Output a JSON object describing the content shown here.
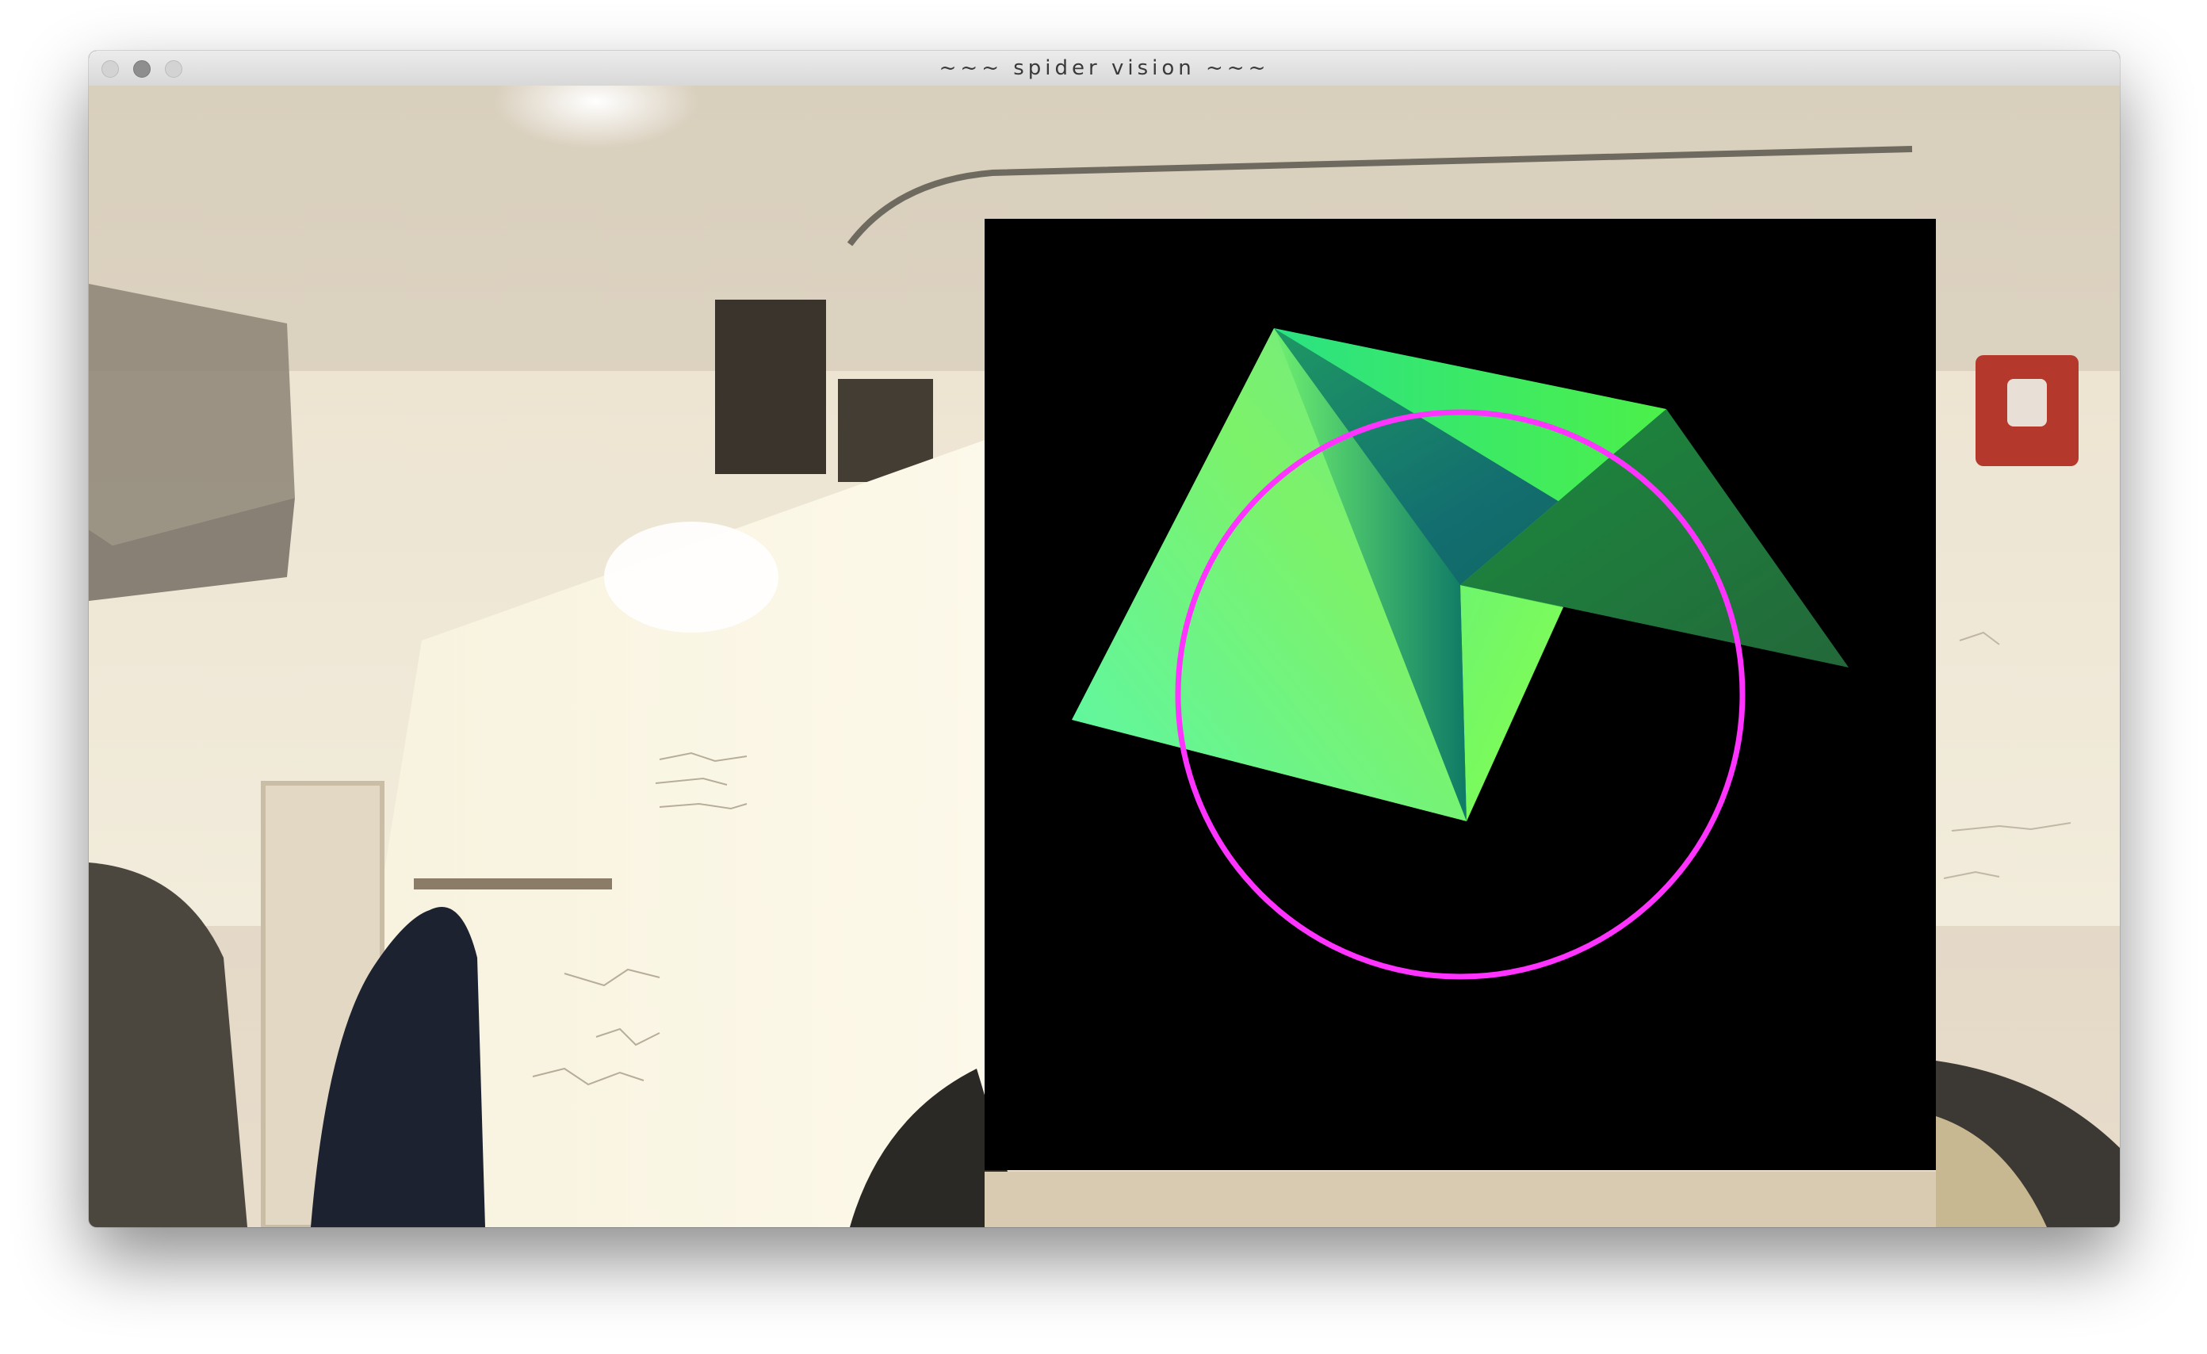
{
  "window": {
    "title": "~~~ spider vision ~~~"
  },
  "icons": {
    "close": "close-icon",
    "minimize": "minimize-icon",
    "zoom": "zoom-icon"
  },
  "overlay": {
    "background_color": "#000000",
    "shape_colors": [
      "#5cf7a8",
      "#7dff54",
      "#1a8a4a",
      "#0f5e6a"
    ],
    "ring_color": "#ff33ff"
  }
}
